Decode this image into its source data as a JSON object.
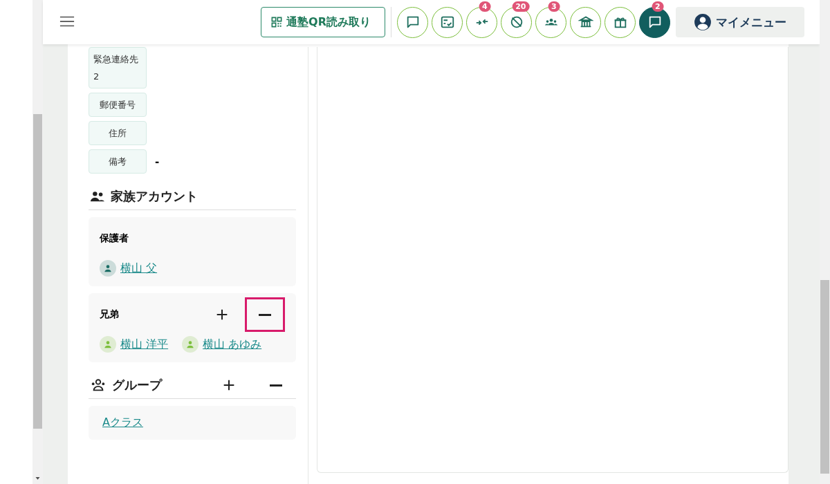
{
  "header": {
    "qr_button": "通塾QR読み取り",
    "icon_buttons": [
      {
        "filled": false
      },
      {
        "filled": false
      },
      {
        "badge": "4",
        "filled": false
      },
      {
        "badge": "20",
        "filled": false
      },
      {
        "badge": "3",
        "filled": false
      },
      {
        "filled": false
      },
      {
        "filled": false
      },
      {
        "badge": "2",
        "filled": true
      }
    ],
    "my_menu": "マイメニュー"
  },
  "profile_fields": [
    {
      "label": "緊急連絡先2"
    },
    {
      "label": "郵便番号"
    },
    {
      "label": "住所"
    },
    {
      "label": "備考",
      "value": "-"
    }
  ],
  "family": {
    "title": "家族アカウント",
    "groups": [
      {
        "title": "保護者",
        "members": [
          {
            "name": "横山 父",
            "color": "#1c6e66"
          }
        ]
      },
      {
        "title": "兄弟",
        "actions": [
          {
            "kind": "add",
            "highlighted": false
          },
          {
            "kind": "remove",
            "highlighted": true
          }
        ],
        "members": [
          {
            "name": "横山 洋平",
            "color": "#7cbf3c"
          },
          {
            "name": "横山 あゆみ",
            "color": "#7cbf3c"
          }
        ]
      }
    ]
  },
  "groups": {
    "title": "グループ",
    "actions": [
      {
        "kind": "add",
        "highlighted": false
      },
      {
        "kind": "remove",
        "highlighted": false
      }
    ],
    "items": [
      "Aクラス"
    ]
  }
}
